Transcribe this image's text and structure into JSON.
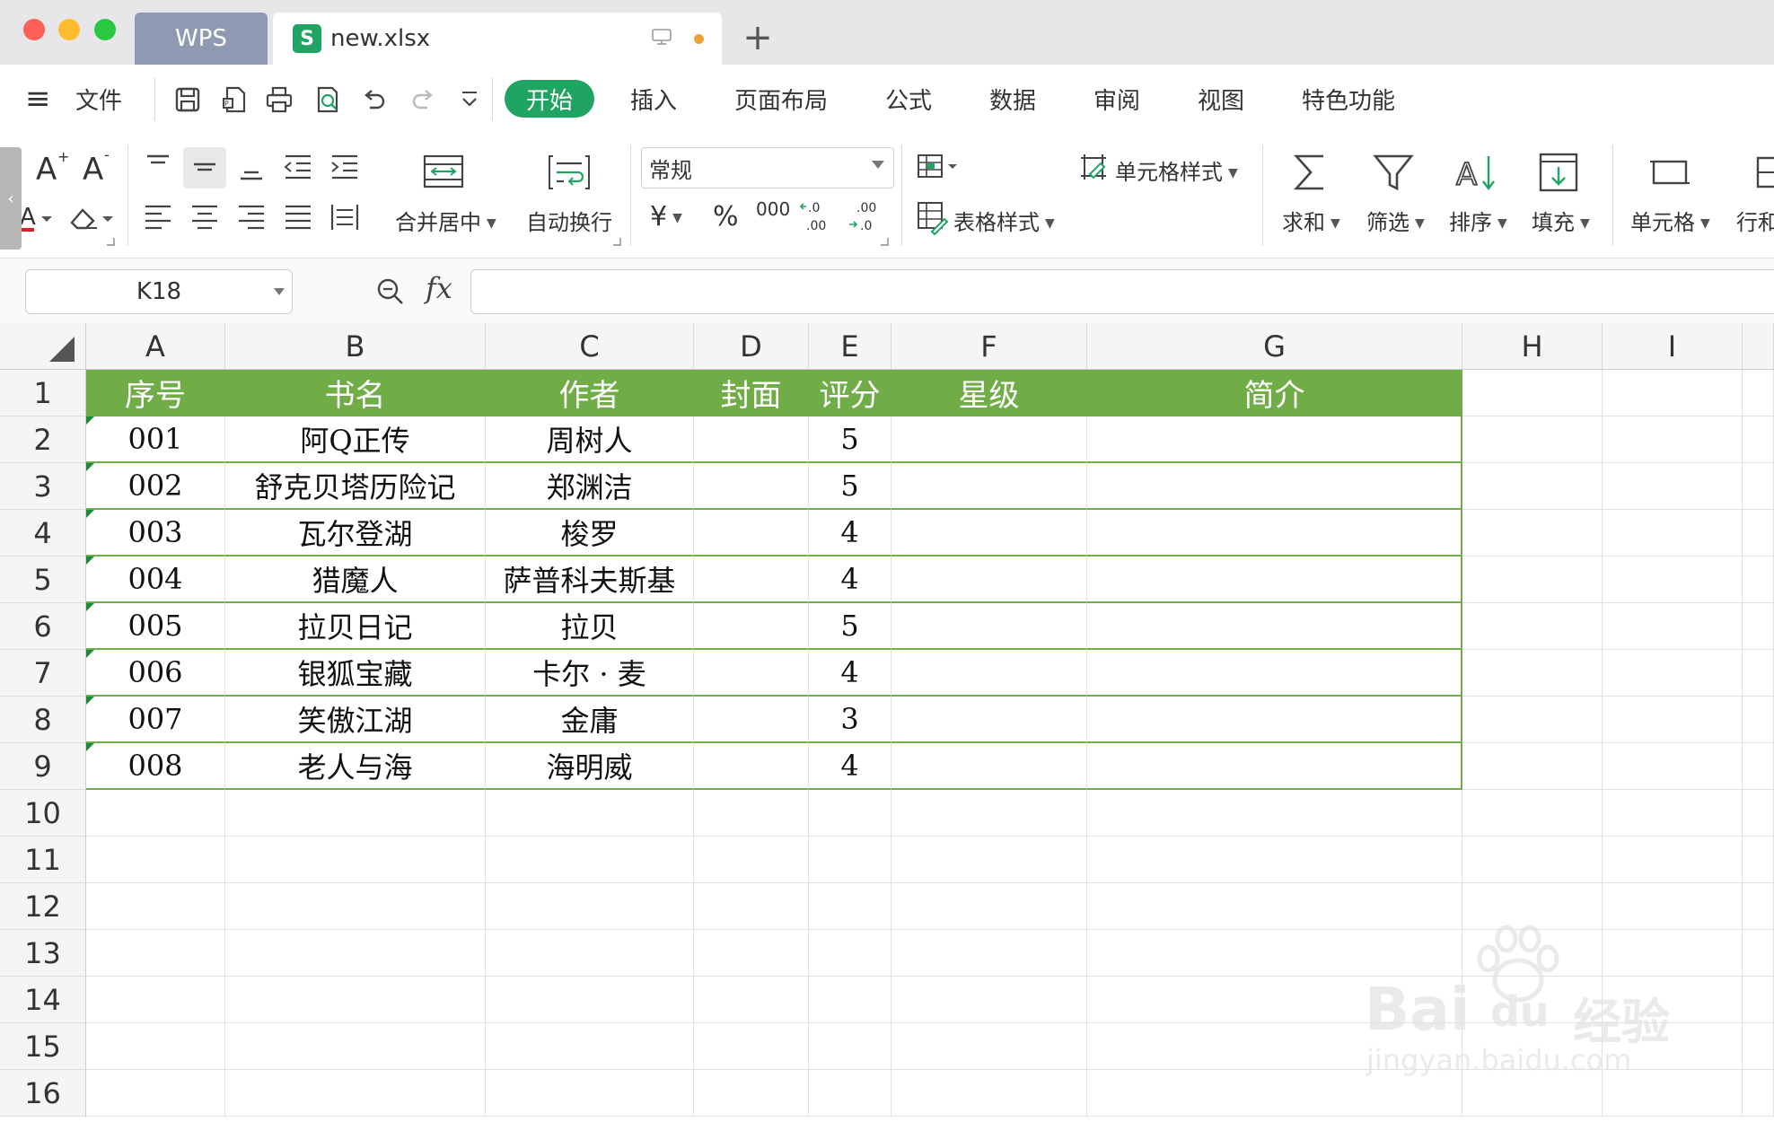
{
  "tabs": {
    "home_label": "WPS",
    "doc_label": "new.xlsx",
    "doc_logo_letter": "S",
    "new_tab_symbol": "+"
  },
  "menu": {
    "hamburger": "≡",
    "file": "文件",
    "items": [
      "开始",
      "插入",
      "页面布局",
      "公式",
      "数据",
      "审阅",
      "视图",
      "特色功能"
    ]
  },
  "ribbon": {
    "merge_center": "合并居中",
    "wrap_text": "自动换行",
    "number_format": "常规",
    "currency": "¥",
    "percent": "%",
    "thousands": "000",
    "cell_style": "单元格样式",
    "table_style": "表格样式",
    "sum": "求和",
    "filter": "筛选",
    "sort": "排序",
    "fill": "填充",
    "cell": "单元格",
    "row_col": "行和"
  },
  "formula_bar": {
    "name_box": "K18",
    "fx_label": "fx",
    "formula_value": ""
  },
  "sheet": {
    "columns": [
      "A",
      "B",
      "C",
      "D",
      "E",
      "F",
      "G",
      "H",
      "I"
    ],
    "rows": [
      "1",
      "2",
      "3",
      "4",
      "5",
      "6",
      "7",
      "8",
      "9",
      "10",
      "11",
      "12",
      "13",
      "14",
      "15",
      "16"
    ],
    "table_header": [
      "序号",
      "书名",
      "作者",
      "封面",
      "评分",
      "星级",
      "简介"
    ],
    "table_rows": [
      [
        "001",
        "阿Q正传",
        "周树人",
        "",
        "5",
        "",
        ""
      ],
      [
        "002",
        "舒克贝塔历险记",
        "郑渊洁",
        "",
        "5",
        "",
        ""
      ],
      [
        "003",
        "瓦尔登湖",
        "梭罗",
        "",
        "4",
        "",
        ""
      ],
      [
        "004",
        "猎魔人",
        "萨普科夫斯基",
        "",
        "4",
        "",
        ""
      ],
      [
        "005",
        "拉贝日记",
        "拉贝",
        "",
        "5",
        "",
        ""
      ],
      [
        "006",
        "银狐宝藏",
        "卡尔 · 麦",
        "",
        "4",
        "",
        ""
      ],
      [
        "007",
        "笑傲江湖",
        "金庸",
        "",
        "3",
        "",
        ""
      ],
      [
        "008",
        "老人与海",
        "海明威",
        "",
        "4",
        "",
        ""
      ]
    ],
    "header_color": "#70ad47"
  },
  "watermark": {
    "brand": "Bai",
    "brand_suffix": "du",
    "brand_cn": "经验",
    "url": "jingyan.baidu.com"
  }
}
